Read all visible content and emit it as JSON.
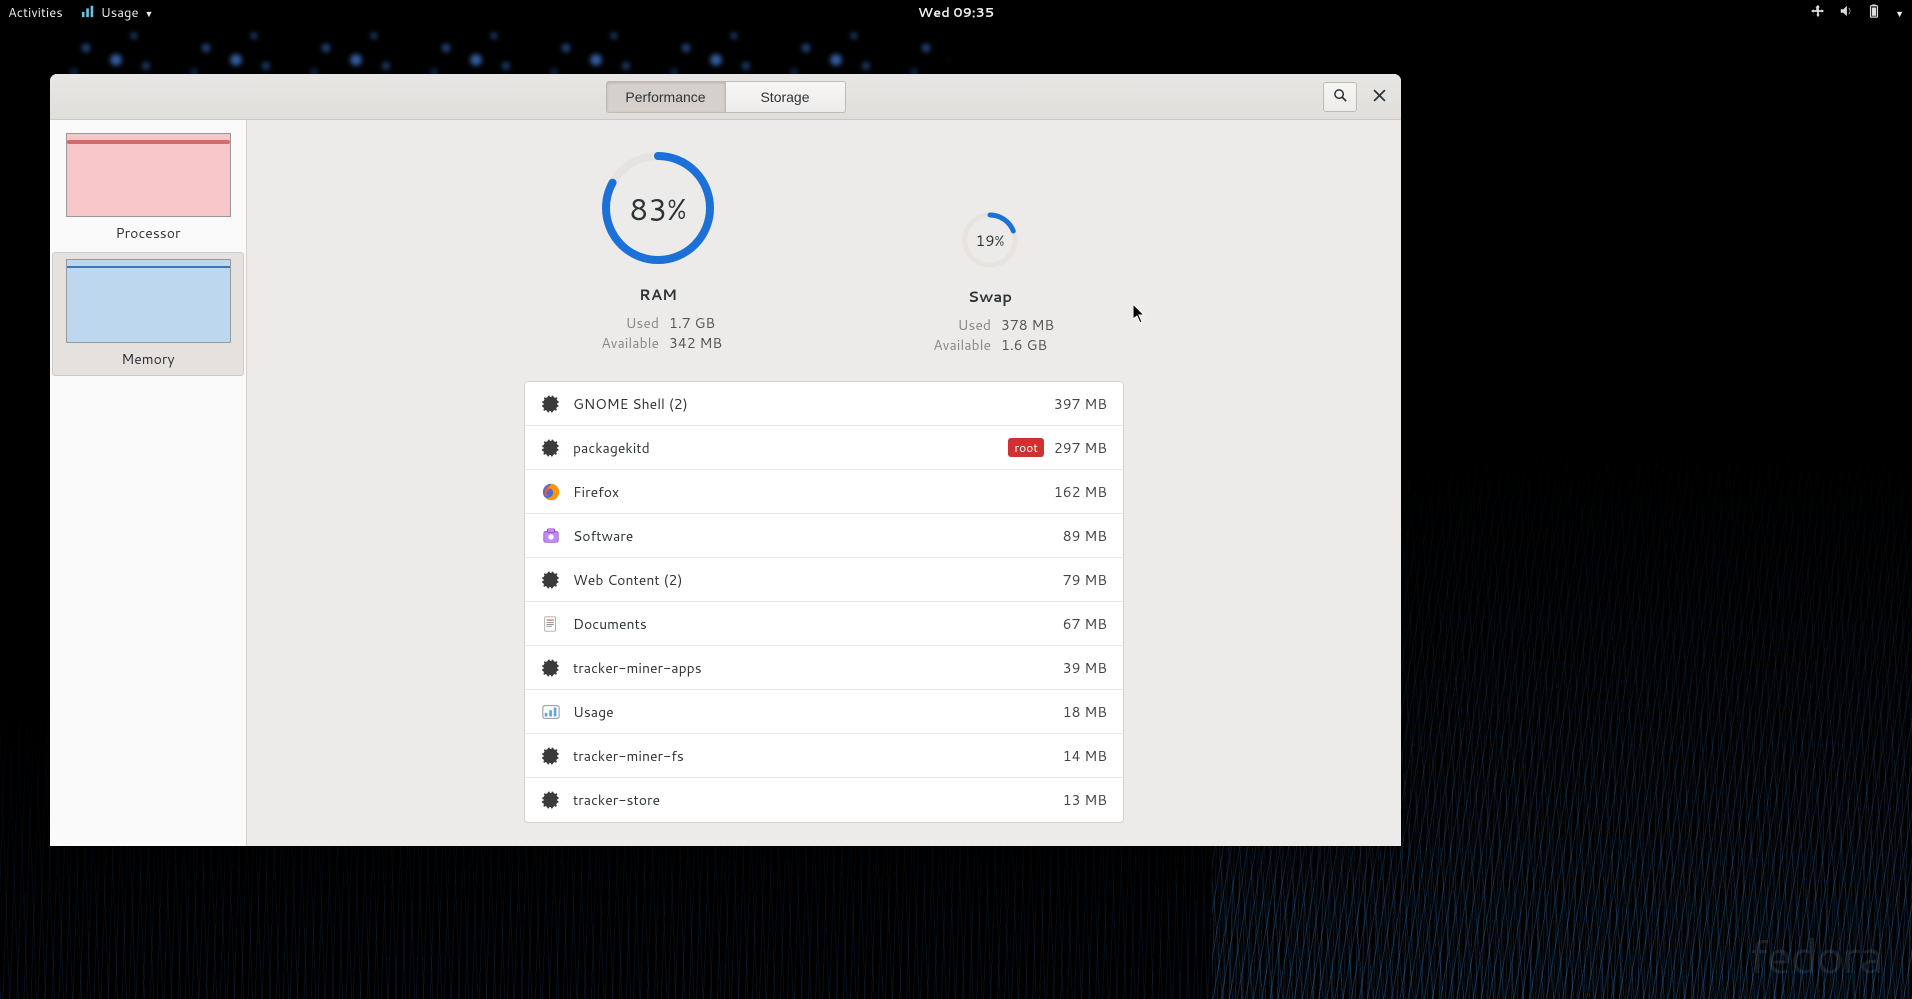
{
  "topbar": {
    "activities": "Activities",
    "app_name": "Usage",
    "clock": "Wed 09:35"
  },
  "window": {
    "tabs": {
      "performance": "Performance",
      "storage": "Storage"
    }
  },
  "sidebar": {
    "items": [
      {
        "label": "Processor"
      },
      {
        "label": "Memory"
      }
    ]
  },
  "gauges": {
    "ram": {
      "percent": 83,
      "percent_label": "83%",
      "title": "RAM",
      "used_label": "Used",
      "used_value": "1.7 GB",
      "avail_label": "Available",
      "avail_value": "342 MB"
    },
    "swap": {
      "percent": 19,
      "percent_label": "19%",
      "title": "Swap",
      "used_label": "Used",
      "used_value": "378 MB",
      "avail_label": "Available",
      "avail_value": "1.6 GB"
    }
  },
  "processes": [
    {
      "icon": "gear",
      "name": "GNOME Shell (2)",
      "tag": null,
      "value": "397 MB"
    },
    {
      "icon": "gear",
      "name": "packagekitd",
      "tag": "root",
      "value": "297 MB"
    },
    {
      "icon": "firefox",
      "name": "Firefox",
      "tag": null,
      "value": "162 MB"
    },
    {
      "icon": "software",
      "name": "Software",
      "tag": null,
      "value": "89 MB"
    },
    {
      "icon": "gear",
      "name": "Web Content (2)",
      "tag": null,
      "value": "79 MB"
    },
    {
      "icon": "documents",
      "name": "Documents",
      "tag": null,
      "value": "67 MB"
    },
    {
      "icon": "gear",
      "name": "tracker-miner-apps",
      "tag": null,
      "value": "39 MB"
    },
    {
      "icon": "usage",
      "name": "Usage",
      "tag": null,
      "value": "18 MB"
    },
    {
      "icon": "gear",
      "name": "tracker-miner-fs",
      "tag": null,
      "value": "14 MB"
    },
    {
      "icon": "gear",
      "name": "tracker-store",
      "tag": null,
      "value": "13 MB"
    }
  ],
  "branding": {
    "distro": "fedora"
  },
  "colors": {
    "accent": "#1c71d8",
    "ring_bg": "#e6e3e0",
    "root_tag": "#cc0000"
  }
}
